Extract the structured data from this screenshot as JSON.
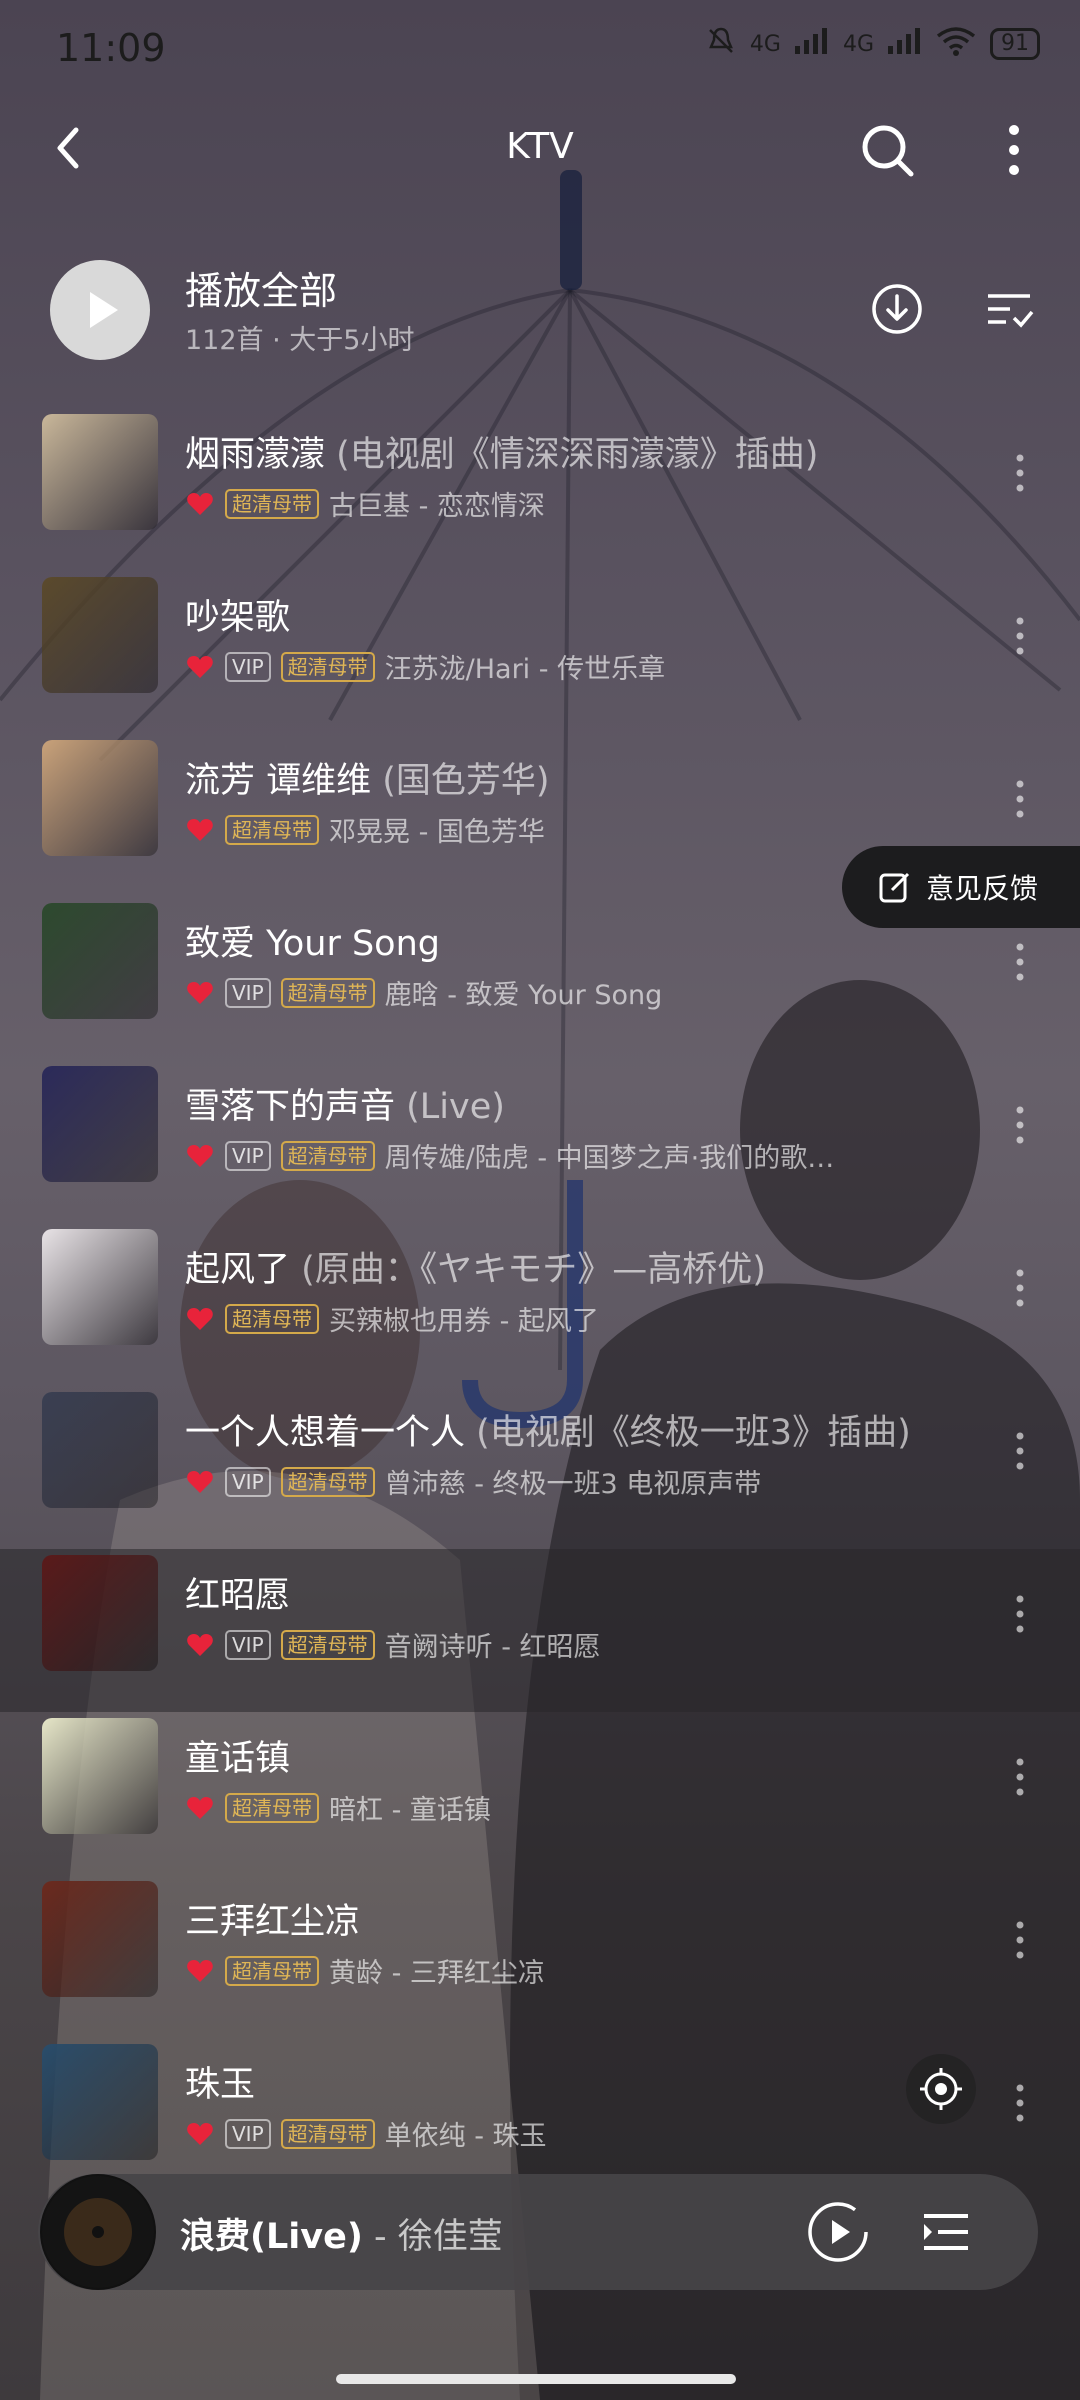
{
  "status_bar": {
    "time": "11:09",
    "network1": "4G",
    "network2": "4G",
    "battery": "91"
  },
  "header": {
    "title": "KTV"
  },
  "play_all": {
    "label": "播放全部",
    "subtitle": "112首 · 大于5小时"
  },
  "feedback": {
    "label": "意见反馈"
  },
  "songs": [
    {
      "title": "烟雨濛濛",
      "subtitle": " (电视剧《情深深雨濛濛》插曲)",
      "vip": "",
      "quality": "超清母带",
      "artist_album": "古巨基 - 恋恋情深",
      "cover_color": "#c9b79a"
    },
    {
      "title": "吵架歌",
      "subtitle": "",
      "vip": "VIP",
      "quality": "超清母带",
      "artist_album": "汪苏泷/Hari - 传世乐章",
      "cover_color": "#5b4a2c"
    },
    {
      "title": "流芳 谭维维",
      "subtitle": " (国色芳华)",
      "vip": "",
      "quality": "超清母带",
      "artist_album": "邓晃晃 - 国色芳华",
      "cover_color": "#c9a27a"
    },
    {
      "title": "致爱 Your Song",
      "subtitle": "",
      "vip": "VIP",
      "quality": "超清母带",
      "artist_album": "鹿晗 - 致爱 Your Song",
      "cover_color": "#2d4a2e"
    },
    {
      "title": "雪落下的声音",
      "subtitle": " (Live)",
      "vip": "VIP",
      "quality": "超清母带",
      "artist_album": "周传雄/陆虎 - 中国梦之声·我们的歌…",
      "cover_color": "#2b2a5a"
    },
    {
      "title": "起风了",
      "subtitle": " (原曲：《ヤキモチ》—高桥优)",
      "vip": "",
      "quality": "超清母带",
      "artist_album": "买辣椒也用券 - 起风了",
      "cover_color": "#e8e3e6"
    },
    {
      "title": "一个人想着一个人",
      "subtitle": " (电视剧《终极一班3》插曲)",
      "vip": "VIP",
      "quality": "超清母带",
      "artist_album": "曾沛慈 - 终极一班3 电视原声带",
      "cover_color": "#3a3f52"
    },
    {
      "title": "红昭愿",
      "subtitle": "",
      "vip": "VIP",
      "quality": "超清母带",
      "artist_album": "音阙诗听 - 红昭愿",
      "cover_color": "#5a1a1a"
    },
    {
      "title": "童话镇",
      "subtitle": "",
      "vip": "",
      "quality": "超清母带",
      "artist_album": "暗杠 - 童话镇",
      "cover_color": "#e6e6c8"
    },
    {
      "title": "三拜红尘凉",
      "subtitle": "",
      "vip": "",
      "quality": "超清母带",
      "artist_album": "黄龄 - 三拜红尘凉",
      "cover_color": "#6b2a1e"
    },
    {
      "title": "珠玉",
      "subtitle": "",
      "vip": "VIP",
      "quality": "超清母带",
      "artist_album": "单依纯 - 珠玉",
      "cover_color": "#2a4d6b"
    }
  ],
  "mini_player": {
    "title": "浪费(Live)",
    "artist": " - 徐佳莹"
  },
  "colors": {
    "heart": "#e8233a",
    "quality_tag": "#d4a94a"
  }
}
